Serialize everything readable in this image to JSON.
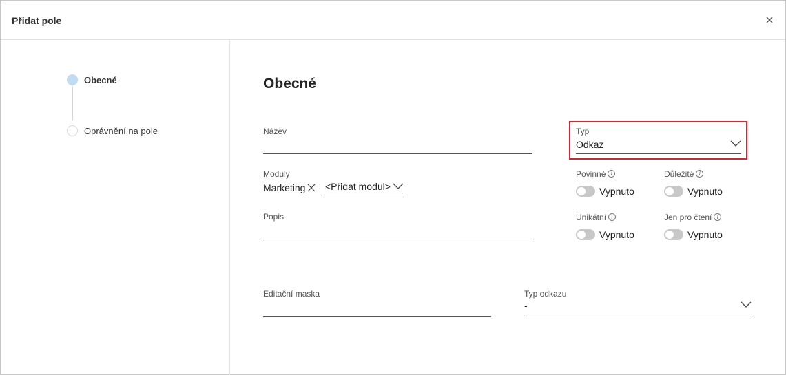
{
  "dialog": {
    "title": "Přidat pole",
    "close_glyph": "×"
  },
  "steps": [
    {
      "label": "Obecné",
      "state": "active"
    },
    {
      "label": "Oprávnění na pole",
      "state": "inactive"
    }
  ],
  "section": {
    "title": "Obecné"
  },
  "fields": {
    "nazev": {
      "label": "Název",
      "value": ""
    },
    "moduly": {
      "label": "Moduly",
      "chip": "Marketing",
      "add_label": "<Přidat modul>"
    },
    "popis": {
      "label": "Popis",
      "value": ""
    },
    "typ": {
      "label": "Typ",
      "value": "Odkaz"
    },
    "editacni_maska": {
      "label": "Editační maska",
      "value": ""
    },
    "typ_odkazu": {
      "label": "Typ odkazu",
      "value": "-"
    }
  },
  "toggles": {
    "povinne": {
      "label": "Povinné",
      "value": "Vypnuto",
      "on": false
    },
    "dulezite": {
      "label": "Důležité",
      "value": "Vypnuto",
      "on": false
    },
    "unikatni": {
      "label": "Unikátní",
      "value": "Vypnuto",
      "on": false
    },
    "jen_pro_cteni": {
      "label": "Jen pro čtení",
      "value": "Vypnuto",
      "on": false
    }
  },
  "info_glyph": "i",
  "colors": {
    "highlight": "#d9232d",
    "step_active": "#c0dcf3",
    "toggle_off": "#c8c8c8"
  }
}
